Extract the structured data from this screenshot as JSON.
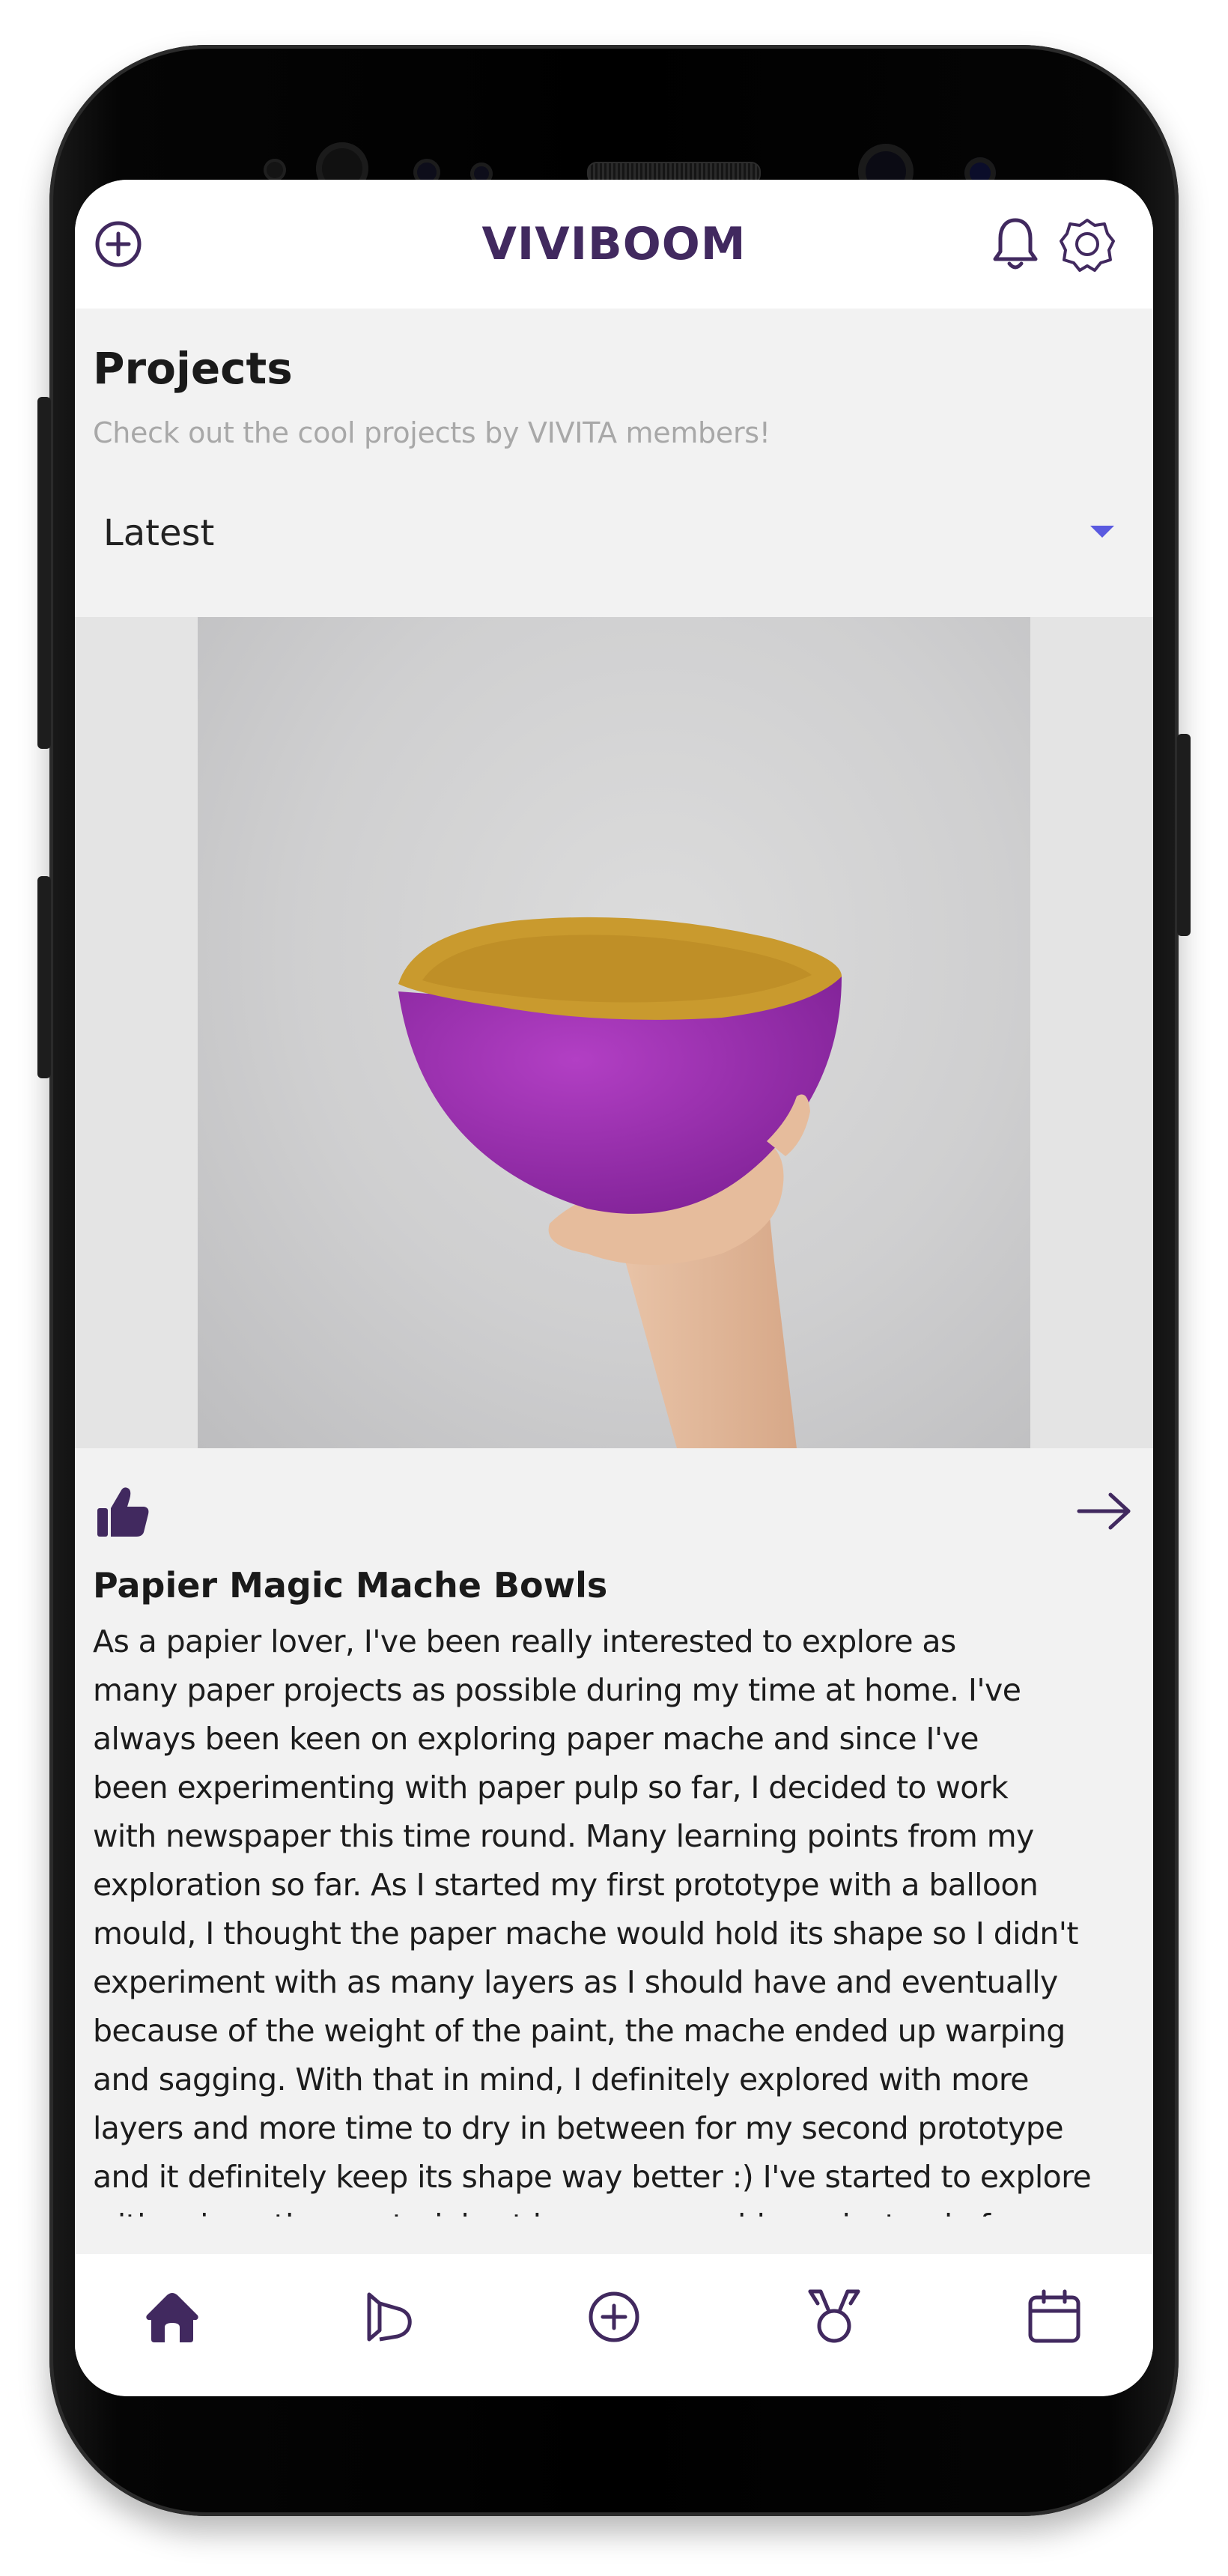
{
  "app": {
    "title": "VIVIBOOM"
  },
  "header": {
    "icons": [
      "add-circle-icon",
      "bell-icon",
      "gear-icon"
    ]
  },
  "page": {
    "title": "Projects",
    "subtitle": "Check out the cool projects by VIVITA members!"
  },
  "sort": {
    "selected": "Latest"
  },
  "project": {
    "title": "Papier Magic Mache Bowls",
    "description": "As a papier lover, I've been really interested to explore as\nmany paper projects as possible during my time at home. I've\nalways been keen on exploring paper mache and since I've\nbeen experimenting with paper pulp so far, I decided to work\nwith newspaper this time round. Many learning points from my\nexploration so far. As I started my first prototype with a balloon\nmould,  I thought the paper mache would hold its shape so I didn't\nexperiment with as many layers as I should have and eventually\nbecause of the weight of the paint, the mache ended up warping\nand sagging. With that in mind, I definitely explored with more\nlayers and more time to dry in between for my second prototype\nand it definitely keep its shape way better :) I've started to explore\nwith using other materials at home as moulds, so instead of"
  },
  "bottom_nav": {
    "items": [
      "home-icon",
      "projects-icon",
      "add-circle-icon",
      "badge-icon",
      "calendar-icon"
    ]
  },
  "colors": {
    "brand": "#41295f",
    "accent": "#5a5ae0",
    "bowl_outer": "#9c2fb0",
    "bowl_inner": "#c99a2e"
  }
}
